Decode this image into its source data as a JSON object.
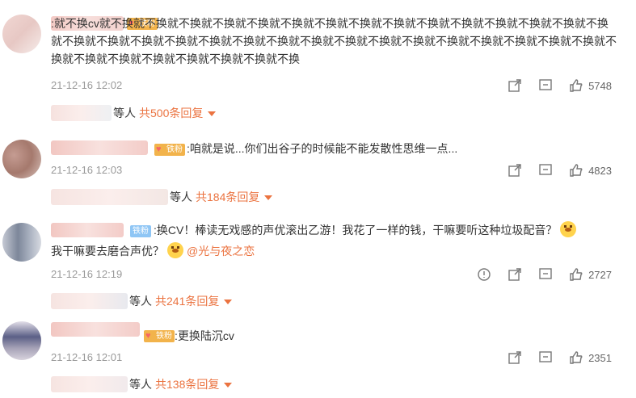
{
  "comments": [
    {
      "badge": "铁粉",
      "text": ":就不换cv就不换就不换就不换就不换就不换就不换就不换就不换就不换就不换就不换就不换就不换就不换就不换就不换就不换就不换就不换就不换就不换就不换就不换就不换就不换就不换就不换就不换就不换就不换就不换就不换就不换就不换就不换就不换就不换就不换就不换",
      "time": "21-12-16 12:02",
      "likes": "5748",
      "reply_suffix": "等人",
      "reply_link": "共500条回复"
    },
    {
      "badge": "铁粉",
      "text": ":咱就是说...你们出谷子的时候能不能发散性思维一点...",
      "time": "21-12-16 12:03",
      "likes": "4823",
      "reply_suffix": "等人",
      "reply_link": "共184条回复"
    },
    {
      "badge": "铁粉",
      "text_a": ":换CV！棒读无戏感的声优滚出乙游！我花了一样的钱，干嘛要听这种垃圾配音？",
      "text_b": "我干嘛要去磨合声优？",
      "mention": "@光与夜之恋",
      "time": "21-12-16 12:19",
      "likes": "2727",
      "reply_suffix": "等人",
      "reply_link": "共241条回复"
    },
    {
      "badge": "铁粉",
      "text": ":更换陆沉cv",
      "time": "21-12-16 12:01",
      "likes": "2351",
      "reply_suffix": "等人",
      "reply_link": "共138条回复"
    }
  ],
  "icons": {
    "share": "share-icon",
    "comment": "comment-icon",
    "like": "like-icon",
    "report": "report-icon"
  },
  "colors": {
    "accent": "#eb7340",
    "badge_gold": "#f2b34b",
    "badge_blue": "#8fc6f5"
  }
}
